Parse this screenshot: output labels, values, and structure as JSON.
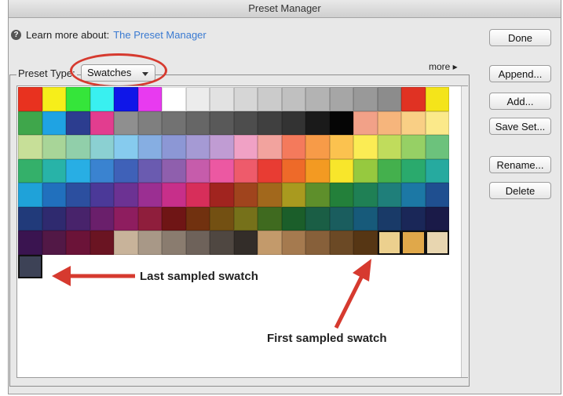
{
  "window": {
    "title": "Preset Manager"
  },
  "info": {
    "prefix": "Learn more about:",
    "link": "The Preset Manager"
  },
  "buttons": {
    "done": "Done",
    "append": "Append...",
    "add": "Add...",
    "save_set": "Save Set...",
    "rename": "Rename...",
    "delete": "Delete"
  },
  "preset": {
    "label": "Preset Type:",
    "value": "Swatches"
  },
  "more_label": "more ▸",
  "annotations": {
    "last": "Last sampled swatch",
    "first": "First sampled swatch"
  },
  "colors": {
    "annotation_red": "#d63a2f"
  },
  "swatches": [
    [
      "#e8321f",
      "#f6ee1a",
      "#35e53a",
      "#39f0f0",
      "#0f16e8",
      "#e83af0",
      "#ffffff",
      "#ececec",
      "#e2e2e2",
      "#d6d6d6",
      "#cbcbcb",
      "#c0c0c0",
      "#b3b3b3",
      "#a6a6a6",
      "#999999",
      "#8c8c8c",
      "#e03223",
      "#f4e41a"
    ],
    [
      "#3fa64b",
      "#1fa3e3",
      "#2c3d8f",
      "#e23d8f",
      "#8f8f8f",
      "#7f7f7f",
      "#727272",
      "#666666",
      "#595959",
      "#4d4d4d",
      "#404040",
      "#333333",
      "#1a1a1a",
      "#050505",
      "#f2a188",
      "#f6b57c",
      "#f9cf85",
      "#fbe98a"
    ],
    [
      "#c7df98",
      "#a8d598",
      "#91cfaa",
      "#8bd0d2",
      "#86cbee",
      "#86aee2",
      "#8c97d5",
      "#a59ad4",
      "#c09cd3",
      "#f0a1c5",
      "#f2a39e",
      "#f47a5c",
      "#f79b48",
      "#fbc24f",
      "#fbec54",
      "#c0dc5c",
      "#96d065",
      "#6cc27c"
    ],
    [
      "#34b06a",
      "#28b3a8",
      "#28aee4",
      "#3a83d0",
      "#3f61b8",
      "#6a5bb0",
      "#8f5fad",
      "#c65cab",
      "#ec58a2",
      "#ee5b6b",
      "#e83c33",
      "#ee6a29",
      "#f39a22",
      "#f8e62b",
      "#96c93f",
      "#44b04d",
      "#2aaa6d",
      "#26aa9f"
    ],
    [
      "#1fa2d9",
      "#2170bd",
      "#2c4f9f",
      "#4b3998",
      "#6c3293",
      "#9b2f92",
      "#c72f8a",
      "#d72e5a",
      "#a1241f",
      "#a0441d",
      "#a2681c",
      "#a99a1f",
      "#5e8f2b",
      "#23803a",
      "#1f8055",
      "#1f7f7a",
      "#1c78a5",
      "#1f4f90"
    ],
    [
      "#213a7a",
      "#2f2a6f",
      "#48236b",
      "#6a1f6b",
      "#8e1d5f",
      "#8f1e3c",
      "#6f1515",
      "#71310f",
      "#735012",
      "#76711a",
      "#3f6a1f",
      "#1b5e2a",
      "#1a5e45",
      "#1a5d5e",
      "#175a7a",
      "#193a68",
      "#1a2758",
      "#1a1a48"
    ],
    [
      "#3a1450",
      "#521846",
      "#6b1338",
      "#6a1422",
      "#c8b39a",
      "#a89887",
      "#8a7c6f",
      "#6e625a",
      "#4f4741",
      "#332d29",
      "#c39a6b",
      "#a57a4f",
      "#87603a",
      "#6b4925",
      "#563614",
      "#ecd08e",
      "#e0a84a",
      "#e8d6b0",
      "#2b5d6e"
    ],
    [
      "#3d4256"
    ]
  ],
  "sampled_indices": [
    [
      6,
      15
    ],
    [
      6,
      16
    ],
    [
      6,
      17
    ],
    [
      6,
      18
    ],
    [
      7,
      0
    ]
  ]
}
